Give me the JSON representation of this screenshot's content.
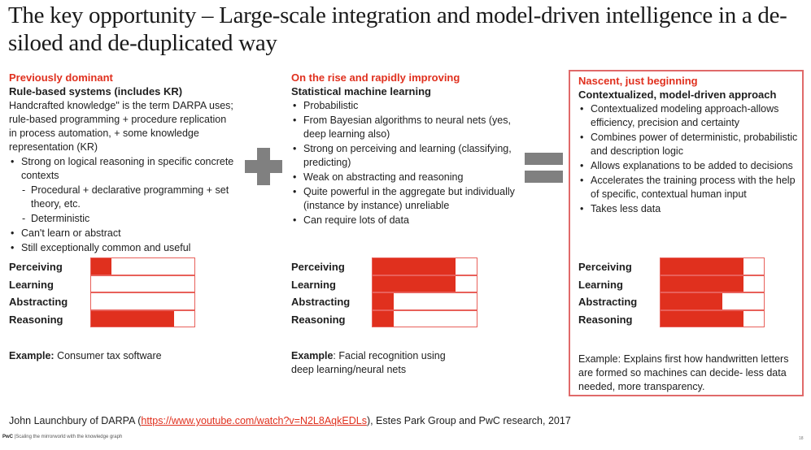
{
  "title": "The key opportunity – Large-scale integration and model-driven intelligence in a de-siloed and de-duplicated way",
  "columns": {
    "left": {
      "kicker": "Previously dominant",
      "heading": "Rule-based systems (includes KR)",
      "intro": "Handcrafted knowledge\" is the term DARPA uses;  rule-based programming + procedure replication in process automation, + some knowledge representation (KR)",
      "bullets": [
        "Strong on logical reasoning in specific concrete contexts",
        "Can't learn or abstract",
        "Still exceptionally common and useful"
      ],
      "subbullets": [
        "Procedural + declarative programming + set theory, etc.",
        "Deterministic"
      ],
      "example_label": "Example:",
      "example_text": " Consumer tax software"
    },
    "mid": {
      "kicker": "On the rise and rapidly improving",
      "heading": "Statistical machine learning",
      "bullets": [
        "Probabilistic",
        "From Bayesian algorithms to neural nets (yes, deep learning also)",
        "Strong on perceiving and learning (classifying, predicting)",
        "Weak on abstracting and reasoning",
        "Quite powerful in the aggregate but individually (instance by instance) unreliable",
        "Can require lots of data"
      ],
      "example_label": "Example",
      "example_text": ": Facial recognition using deep learning/neural nets"
    },
    "right": {
      "kicker": "Nascent, just beginning",
      "heading": "Contextualized, model-driven approach",
      "bullets": [
        "Contextualized modeling approach-allows efficiency, precision and certainty",
        "Combines power of deterministic, probabilistic and description logic",
        "Allows explanations to be added to decisions",
        "Accelerates the training process with the help of specific, contextual human input",
        "Takes less data"
      ],
      "example_text": "Example: Explains first how handwritten letters are formed so machines can decide- less  data needed, more transparency."
    }
  },
  "operators": {
    "plus": "plus-sign",
    "equals": "equals-sign"
  },
  "capability_labels": [
    "Perceiving",
    "Learning",
    "Abstracting",
    "Reasoning"
  ],
  "capability_ratings": {
    "left": [
      0.2,
      0.0,
      0.0,
      0.8
    ],
    "mid": [
      0.8,
      0.8,
      0.2,
      0.2
    ],
    "right": [
      0.8,
      0.8,
      0.6,
      0.8
    ]
  },
  "source": {
    "prefix": "John Launchbury of DARPA (",
    "link": "https://www.youtube.com/watch?v=N2L8AqkEDLs",
    "suffix": "), Estes Park Group and PwC research, 2017"
  },
  "footer": {
    "brand": "PwC",
    "text": " |Scaling the mirrorworld with the knowledge graph"
  },
  "page_number": "18",
  "colors": {
    "accent": "#e0301e",
    "operator": "#808080",
    "bar_border": "#e8605a"
  }
}
